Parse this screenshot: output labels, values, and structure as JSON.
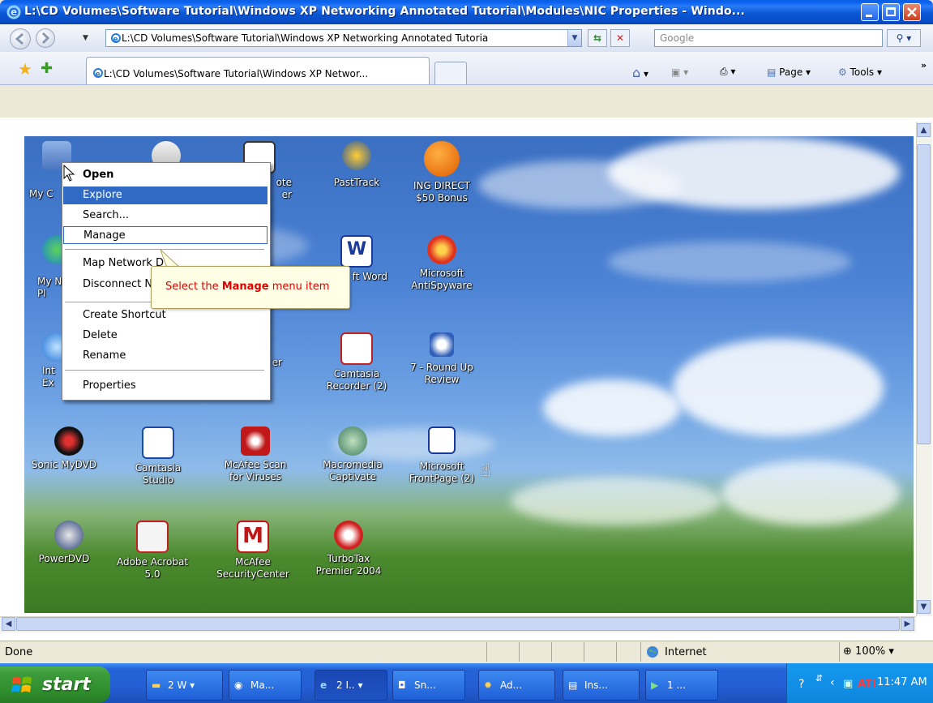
{
  "window": {
    "title": "L:\\CD Volumes\\Software Tutorial\\Windows XP Networking Annotated Tutorial\\Modules\\NIC Properties - Windo..."
  },
  "address_bar": {
    "url": "L:\\CD Volumes\\Software Tutorial\\Windows XP Networking Annotated Tutoria",
    "search_placeholder": "Google"
  },
  "tabs": {
    "active_label": "L:\\CD Volumes\\Software Tutorial\\Windows XP Networ..."
  },
  "toolbar": {
    "page_label": "Page",
    "tools_label": "Tools"
  },
  "desktop_icons": [
    {
      "label": "My C",
      "icon": "my-computer-icon"
    },
    {
      "label": "",
      "icon": "app-icon"
    },
    {
      "label": "ote\ner",
      "icon": "ink-icon"
    },
    {
      "label": "PastTrack",
      "icon": "pasttrack-icon"
    },
    {
      "label": "ING DIRECT\n$50 Bonus",
      "icon": "ing-direct-icon"
    },
    {
      "label": "My N\nPl",
      "icon": "network-places-icon"
    },
    {
      "label": "ft Word",
      "icon": "word-icon"
    },
    {
      "label": "Microsoft\nAntiSpyware",
      "icon": "antispyware-icon"
    },
    {
      "label": "Int\nEx",
      "icon": "ie-icon"
    },
    {
      "label": "er",
      "icon": "app-icon"
    },
    {
      "label": "Camtasia\nRecorder (2)",
      "icon": "camtasia-recorder-icon"
    },
    {
      "label": "7 - Round Up\nReview",
      "icon": "media-player-icon"
    },
    {
      "label": "Sonic MyDVD",
      "icon": "mydvd-icon"
    },
    {
      "label": "Camtasia\nStudio",
      "icon": "camtasia-studio-icon"
    },
    {
      "label": "McAfee Scan\nfor Viruses",
      "icon": "mcafee-scan-icon"
    },
    {
      "label": "Macromedia\nCaptivate",
      "icon": "captivate-icon"
    },
    {
      "label": "Microsoft\nFrontPage (2)",
      "icon": "frontpage-icon"
    },
    {
      "label": "PowerDVD",
      "icon": "powerdvd-icon"
    },
    {
      "label": "Adobe Acrobat\n5.0",
      "icon": "acrobat-icon"
    },
    {
      "label": "McAfee\nSecurityCenter",
      "icon": "mcafee-securitycenter-icon"
    },
    {
      "label": "TurboTax\nPremier 2004",
      "icon": "turbotax-icon"
    }
  ],
  "context_menu": {
    "items": [
      "Open",
      "Explore",
      "Search...",
      "Manage",
      "Map Network Drive...",
      "Disconnect Network Drive...",
      "Create Shortcut",
      "Delete",
      "Rename",
      "Properties"
    ],
    "visible_text": {
      "map": "Map Network D",
      "disconnect": "Disconnect N"
    }
  },
  "callout": {
    "prefix": "Select the ",
    "bold": "Manage",
    "suffix": " menu item"
  },
  "status_bar": {
    "text": "Done",
    "zone": "Internet",
    "zoom": "100%"
  },
  "taskbar": {
    "start_label": "start",
    "tasks": [
      "2 W",
      "Ma...",
      "2 I..",
      "Sn...",
      "Ad...",
      "Ins...",
      "1 ..."
    ],
    "clock": "11:47 AM"
  },
  "colors": {
    "title_blue": "#0b57d6",
    "menu_highlight": "#316ac5",
    "callout_text": "#e00000",
    "start_green": "#3c9b3a"
  }
}
